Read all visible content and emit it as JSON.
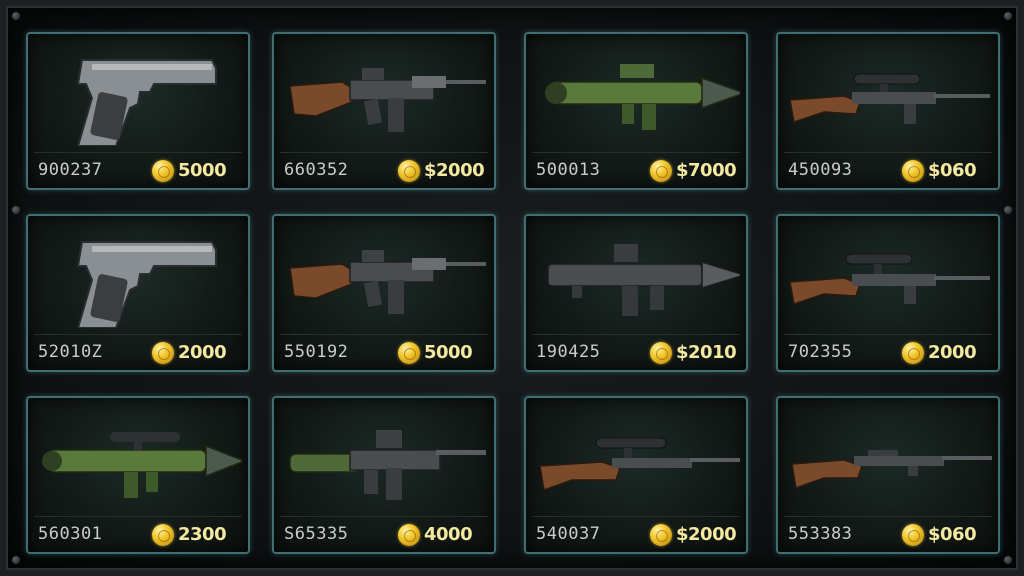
{
  "inventory": {
    "slots": [
      {
        "weapon": "pistol",
        "code": "900237",
        "price": "5000"
      },
      {
        "weapon": "assault-rifle",
        "code": "660352",
        "price": "$2000"
      },
      {
        "weapon": "rocket-launcher-green",
        "code": "500013",
        "price": "$7000"
      },
      {
        "weapon": "sniper-rifle",
        "code": "450093",
        "price": "$060"
      },
      {
        "weapon": "pistol",
        "code": "52010Z",
        "price": "2000"
      },
      {
        "weapon": "assault-rifle",
        "code": "550192",
        "price": "5000"
      },
      {
        "weapon": "rocket-launcher-gray",
        "code": "190425",
        "price": "$2010"
      },
      {
        "weapon": "sniper-rifle",
        "code": "702355",
        "price": "2000"
      },
      {
        "weapon": "rocket-launcher-green-scoped",
        "code": "560301",
        "price": "2300"
      },
      {
        "weapon": "launcher-rifle",
        "code": "S65335",
        "price": "4000"
      },
      {
        "weapon": "hunting-rifle",
        "code": "540037",
        "price": "$2000"
      },
      {
        "weapon": "long-rifle",
        "code": "553383",
        "price": "$060"
      }
    ]
  },
  "colors": {
    "slot_border": "#3f6f72",
    "price_text": "#f4e9a0",
    "code_text": "#c8cccd",
    "coin": "#f2c52a"
  }
}
